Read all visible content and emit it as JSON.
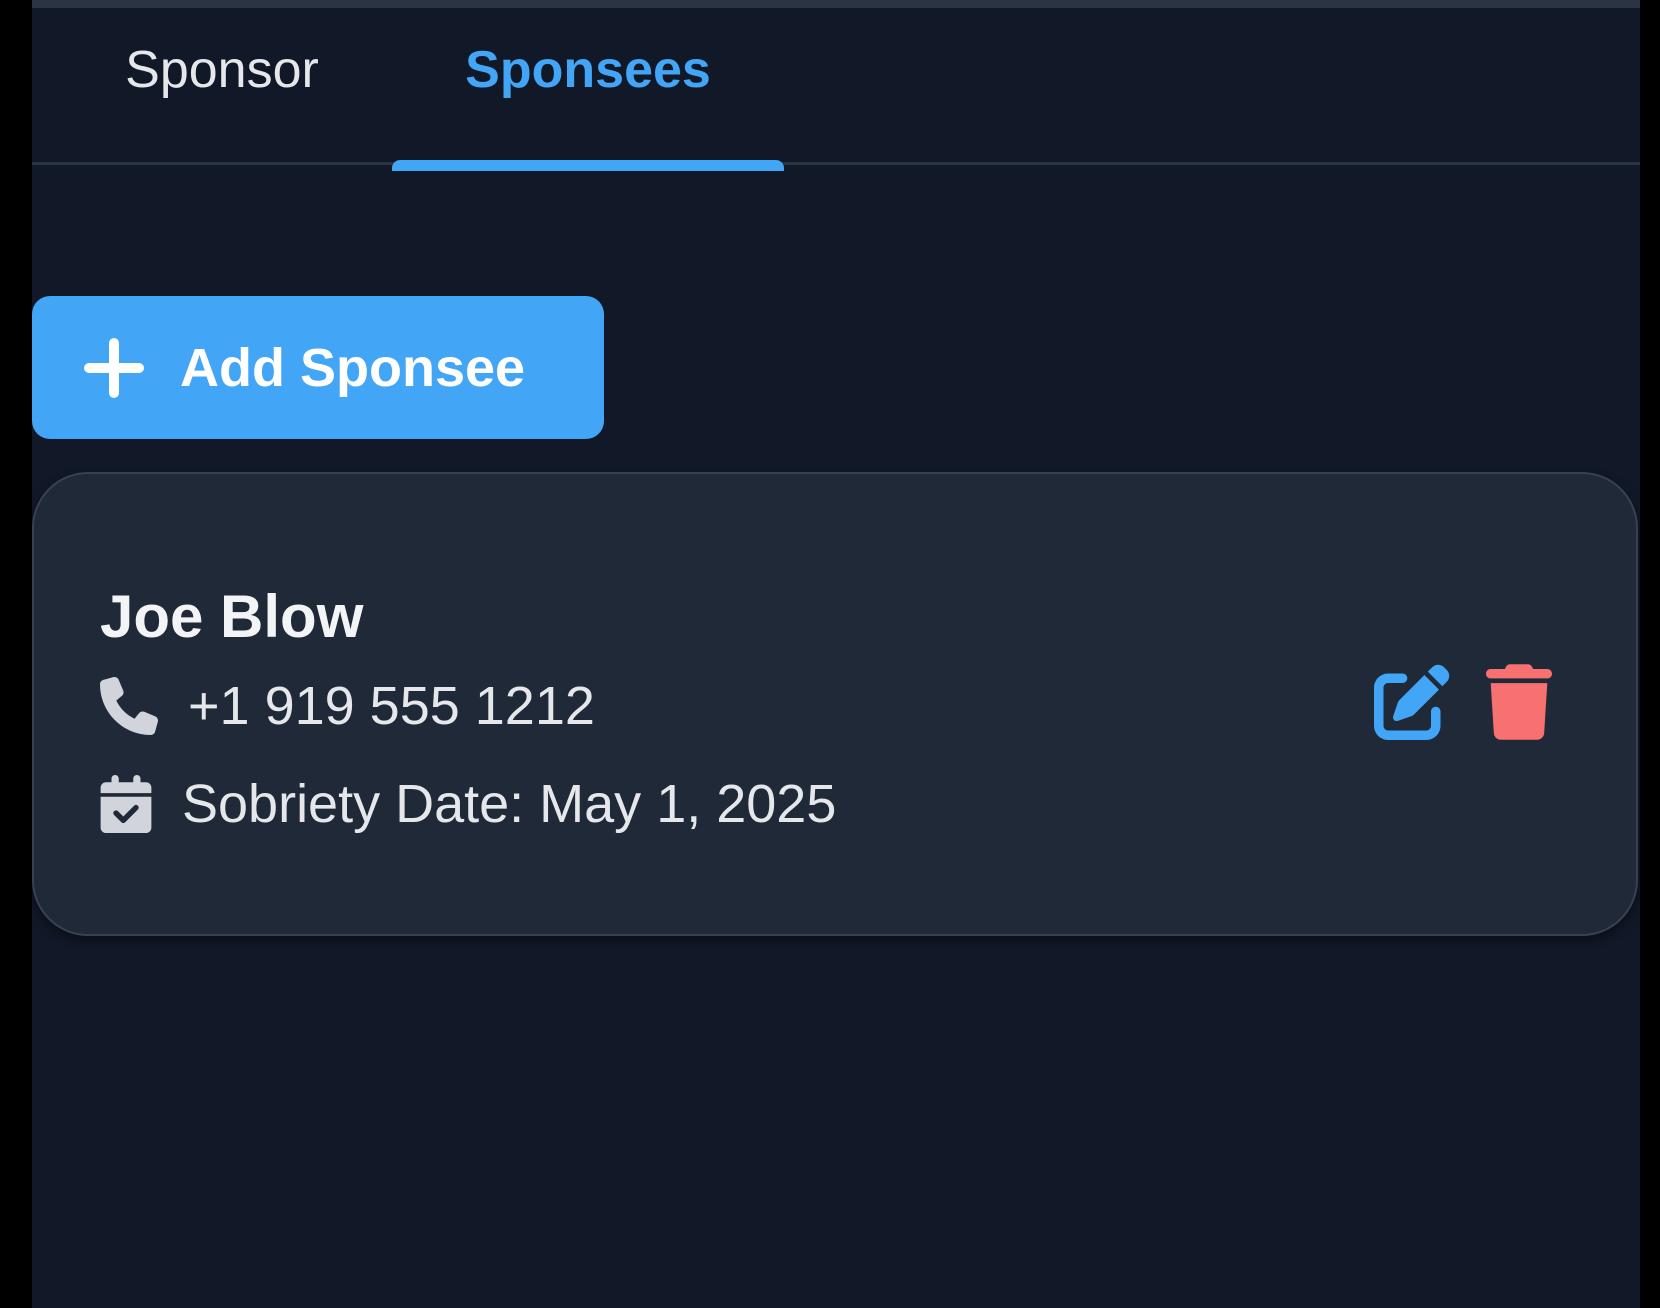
{
  "tabs": [
    {
      "label": "Sponsor",
      "active": false
    },
    {
      "label": "Sponsees",
      "active": true
    }
  ],
  "add_button": {
    "label": "Add Sponsee",
    "icon": "plus-icon"
  },
  "sponsees": [
    {
      "name": "Joe Blow",
      "phone": "+1 919 555 1212",
      "phone_icon": "phone-icon",
      "sobriety_label": "Sobriety Date: May 1, 2025",
      "date_icon": "calendar-check-icon",
      "actions": [
        {
          "name": "edit",
          "icon": "edit-icon",
          "color": "#42a5f5"
        },
        {
          "name": "delete",
          "icon": "trash-icon",
          "color": "#f87171"
        }
      ]
    }
  ],
  "colors": {
    "background": "#111827",
    "card": "#1f2937",
    "accent": "#42a5f5",
    "danger": "#f87171",
    "text": "#e5e7eb"
  }
}
